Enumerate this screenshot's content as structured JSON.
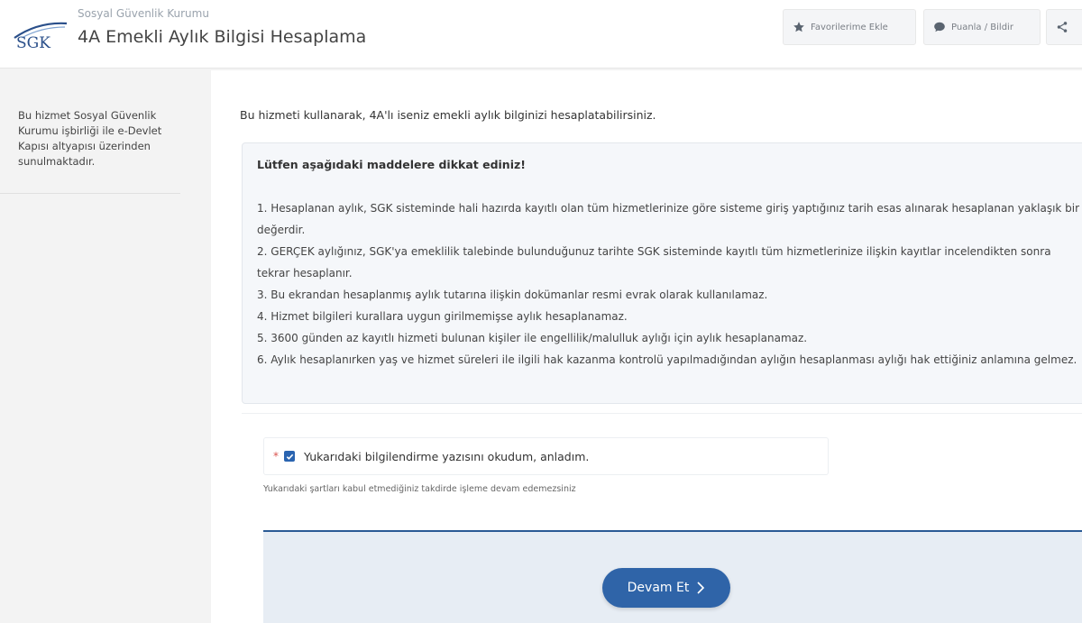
{
  "header": {
    "logo_text": "SGK",
    "org_name": "Sosyal Güvenlik Kurumu",
    "page_title": "4A Emekli Aylık Bilgisi Hesaplama",
    "favorite_label": "Favorilerime Ekle",
    "rate_label": "Puanla / Bildir"
  },
  "sidebar": {
    "info_text": "Bu hizmet Sosyal Güvenlik Kurumu işbirliği ile e-Devlet Kapısı altyapısı üzerinden sunulmaktadır."
  },
  "main": {
    "intro": "Bu hizmeti kullanarak, 4A'lı iseniz emekli aylık bilginizi hesaplatabilirsiniz.",
    "notice_title": "Lütfen aşağıdaki maddelere dikkat ediniz!",
    "notice_items": [
      "1. Hesaplanan aylık, SGK sisteminde hali hazırda kayıtlı olan tüm hizmetlerinize göre sisteme giriş yaptığınız tarih esas alınarak hesaplanan yaklaşık bir değerdir.",
      "2. GERÇEK aylığınız, SGK'ya emeklilik talebinde bulunduğunuz tarihte SGK sisteminde kayıtlı tüm hizmetlerinize ilişkin kayıtlar incelendikten sonra tekrar hesaplanır.",
      "3. Bu ekrandan hesaplanmış aylık tutarına ilişkin dokümanlar resmi evrak olarak kullanılamaz.",
      "4. Hizmet bilgileri kurallara uygun girilmemişse aylık hesaplanamaz.",
      "5. 3600 günden az kayıtlı hizmeti bulunan kişiler ile engellilik/malulluk aylığı için aylık hesaplanamaz.",
      "6. Aylık hesaplanırken yaş ve hizmet süreleri ile ilgili hak kazanma kontrolü yapılmadığından aylığın hesaplanması aylığı hak ettiğiniz anlamına gelmez."
    ],
    "required_mark": "*",
    "checkbox_label": "Yukarıdaki bilgilendirme yazısını okudum, anladım.",
    "checkbox_checked": true,
    "terms_hint": "Yukarıdaki şartları kabul etmediğiniz takdirde işleme devam edemezsiniz",
    "continue_label": "Devam Et"
  },
  "colors": {
    "brand": "#2f64a8",
    "logo": "#2a4f8a",
    "footer_band": "#e7edf4"
  }
}
